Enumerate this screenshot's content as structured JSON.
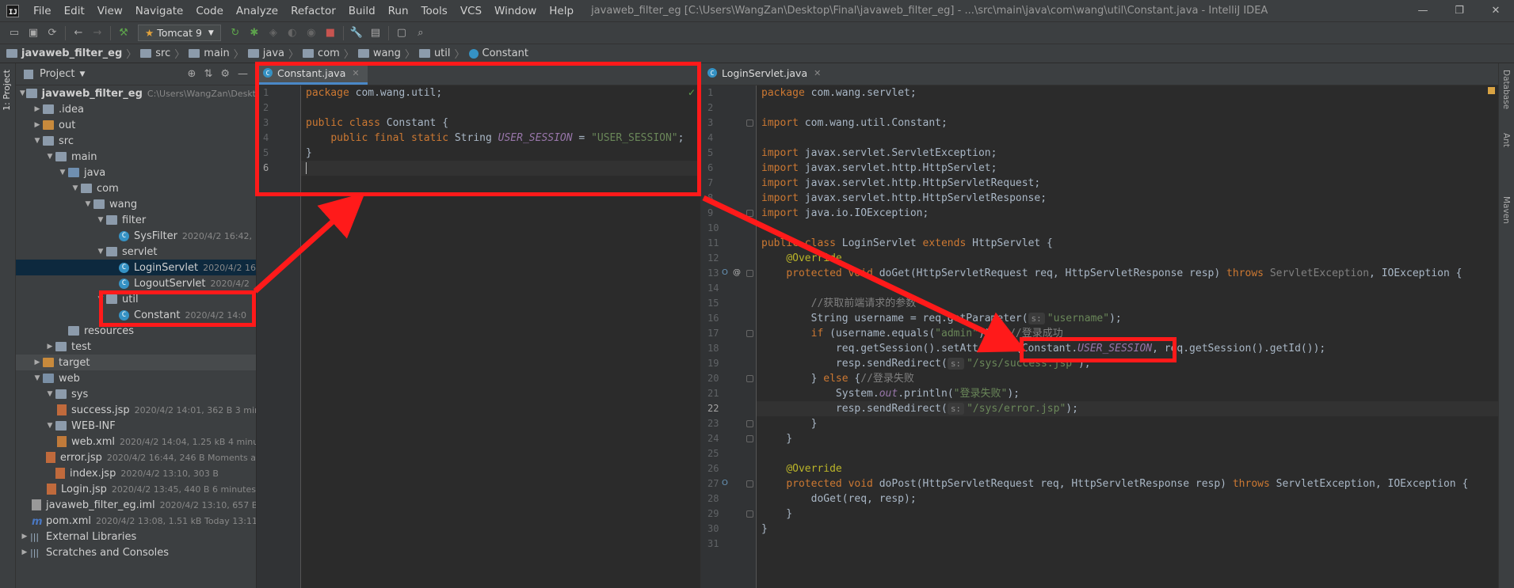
{
  "window": {
    "title": "javaweb_filter_eg [C:\\Users\\WangZan\\Desktop\\Final\\javaweb_filter_eg] - ...\\src\\main\\java\\com\\wang\\util\\Constant.java - IntelliJ IDEA",
    "min": "—",
    "max": "❐",
    "close": "✕"
  },
  "menu": [
    "File",
    "Edit",
    "View",
    "Navigate",
    "Code",
    "Analyze",
    "Refactor",
    "Build",
    "Run",
    "Tools",
    "VCS",
    "Window",
    "Help"
  ],
  "toolbar": {
    "run_config": "Tomcat 9"
  },
  "breadcrumb": [
    "javaweb_filter_eg",
    "src",
    "main",
    "java",
    "com",
    "wang",
    "util",
    "Constant"
  ],
  "project_panel": {
    "title": "Project"
  },
  "tree": [
    {
      "level": 0,
      "arrow": "▼",
      "icon": "f-plain",
      "name": "javaweb_filter_eg",
      "meta": "C:\\Users\\WangZan\\Deskt"
    },
    {
      "level": 1,
      "arrow": "▶",
      "icon": "f-plain",
      "name": ".idea",
      "meta": ""
    },
    {
      "level": 1,
      "arrow": "▶",
      "icon": "f-orange",
      "name": "out",
      "meta": ""
    },
    {
      "level": 1,
      "arrow": "▼",
      "icon": "f-plain",
      "name": "src",
      "meta": ""
    },
    {
      "level": 2,
      "arrow": "▼",
      "icon": "f-plain",
      "name": "main",
      "meta": ""
    },
    {
      "level": 3,
      "arrow": "▼",
      "icon": "f-src",
      "name": "java",
      "meta": ""
    },
    {
      "level": 4,
      "arrow": "▼",
      "icon": "f-plain",
      "name": "com",
      "meta": ""
    },
    {
      "level": 5,
      "arrow": "▼",
      "icon": "f-plain",
      "name": "wang",
      "meta": ""
    },
    {
      "level": 6,
      "arrow": "▼",
      "icon": "f-plain",
      "name": "filter",
      "meta": ""
    },
    {
      "level": 7,
      "arrow": "",
      "icon": "cls",
      "name": "SysFilter",
      "meta": "2020/4/2 16:42,"
    },
    {
      "level": 6,
      "arrow": "▼",
      "icon": "f-plain",
      "name": "servlet",
      "meta": ""
    },
    {
      "level": 7,
      "arrow": "",
      "icon": "cls",
      "name": "LoginServlet",
      "meta": "2020/4/2 16",
      "sel": true
    },
    {
      "level": 7,
      "arrow": "",
      "icon": "cls",
      "name": "LogoutServlet",
      "meta": "2020/4/2"
    },
    {
      "level": 6,
      "arrow": "▼",
      "icon": "f-plain",
      "name": "util",
      "meta": ""
    },
    {
      "level": 7,
      "arrow": "",
      "icon": "cls",
      "name": "Constant",
      "meta": "2020/4/2 14:0"
    },
    {
      "level": 3,
      "arrow": "",
      "icon": "f-plain",
      "name": "resources",
      "meta": ""
    },
    {
      "level": 2,
      "arrow": "▶",
      "icon": "f-plain",
      "name": "test",
      "meta": ""
    },
    {
      "level": 1,
      "arrow": "▶",
      "icon": "f-orange",
      "name": "target",
      "meta": "",
      "alt": true
    },
    {
      "level": 1,
      "arrow": "▼",
      "icon": "f-blue",
      "name": "web",
      "meta": ""
    },
    {
      "level": 2,
      "arrow": "▼",
      "icon": "f-plain",
      "name": "sys",
      "meta": ""
    },
    {
      "level": 3,
      "arrow": "",
      "icon": "jsp",
      "name": "success.jsp",
      "meta": "2020/4/2 14:01, 362 B 3 min"
    },
    {
      "level": 2,
      "arrow": "▼",
      "icon": "f-plain",
      "name": "WEB-INF",
      "meta": ""
    },
    {
      "level": 3,
      "arrow": "",
      "icon": "xml",
      "name": "web.xml",
      "meta": "2020/4/2 14:04, 1.25 kB 4 minu"
    },
    {
      "level": 2,
      "arrow": "",
      "icon": "jsp",
      "name": "error.jsp",
      "meta": "2020/4/2 16:44, 246 B Moments a"
    },
    {
      "level": 2,
      "arrow": "",
      "icon": "jsp",
      "name": "index.jsp",
      "meta": "2020/4/2 13:10, 303 B"
    },
    {
      "level": 2,
      "arrow": "",
      "icon": "jsp",
      "name": "Login.jsp",
      "meta": "2020/4/2 13:45, 440 B 6 minutes"
    },
    {
      "level": 1,
      "arrow": "",
      "icon": "iml",
      "name": "javaweb_filter_eg.iml",
      "meta": "2020/4/2 13:10, 657 B"
    },
    {
      "level": 1,
      "arrow": "",
      "icon": "mvn",
      "name": "pom.xml",
      "meta": "2020/4/2 13:08, 1.51 kB Today 13:11"
    },
    {
      "level": 0,
      "arrow": "▶",
      "icon": "lib",
      "name": "External Libraries",
      "meta": ""
    },
    {
      "level": 0,
      "arrow": "▶",
      "icon": "lib",
      "name": "Scratches and Consoles",
      "meta": ""
    }
  ],
  "left_editor": {
    "tab": "Constant.java",
    "lines": [
      "<span class=\"kw\">package</span> com.wang.util;",
      "",
      "<span class=\"kw\">public class</span> Constant {",
      "    <span class=\"kw\">public final static</span> String <span class=\"fld\">USER_SESSION</span> = <span class=\"str\">\"USER_SESSION\"</span>;",
      "}",
      ""
    ],
    "current_line": 6
  },
  "right_editor": {
    "tab": "LoginServlet.java",
    "lines": [
      "<span class=\"kw\">package</span> com.wang.servlet;",
      "",
      "<span class=\"kw\">import</span> com.wang.util.Constant;",
      "",
      "<span class=\"kw\">import</span> javax.servlet.ServletException;",
      "<span class=\"kw\">import</span> javax.servlet.http.HttpServlet;",
      "<span class=\"kw\">import</span> javax.servlet.http.HttpServletRequest;",
      "<span class=\"kw\">import</span> javax.servlet.http.HttpServletResponse;",
      "<span class=\"kw\">import</span> java.io.IOException;",
      "",
      "<span class=\"kw\">public class</span> LoginServlet <span class=\"kw\">extends</span> HttpServlet {",
      "    <span class=\"ann\">@Override</span>",
      "    <span class=\"kw\">protected void</span> doGet(HttpServletRequest req, HttpServletResponse resp) <span class=\"kw\">throws</span> <span style=\"color:#808080\">ServletException</span>, IOException {",
      "",
      "        <span class=\"cmt\">//获取前端请求的参数</span>",
      "        String username = req.getParameter(<span class=\"hint\">s:</span><span class=\"str\">\"username\"</span>);",
      "        <span class=\"kw\">if</span> (username.equals(<span class=\"str\">\"admin\"</span>)) { <span class=\"cmt\">//登录成功</span>",
      "            req.getSession().setAttribute(Constant.<span class=\"fld\">USER_SESSION</span>, req.getSession().getId());",
      "            resp.sendRedirect(<span class=\"hint\">s:</span><span class=\"str\">\"/sys/success.jsp\"</span>);",
      "        } <span class=\"kw\">else</span> {<span class=\"cmt\">//登录失败</span>",
      "            System.<span class=\"fld\">out</span>.println(<span class=\"str\">\"登录失败\"</span>);",
      "            resp.sendRedirect(<span class=\"hint\">s:</span><span class=\"str\">\"/sys/error.jsp\"</span>);",
      "        }",
      "    }",
      "",
      "    <span class=\"ann\">@Override</span>",
      "    <span class=\"kw\">protected void</span> doPost(HttpServletRequest req, HttpServletResponse resp) <span class=\"kw\">throws</span> ServletException, IOException {",
      "        doGet(req, resp);",
      "    }",
      "}",
      ""
    ],
    "current_line": 22
  },
  "right_strip_labels": [
    "Database",
    "Ant",
    "Maven"
  ],
  "left_strip_label": "1: Project"
}
